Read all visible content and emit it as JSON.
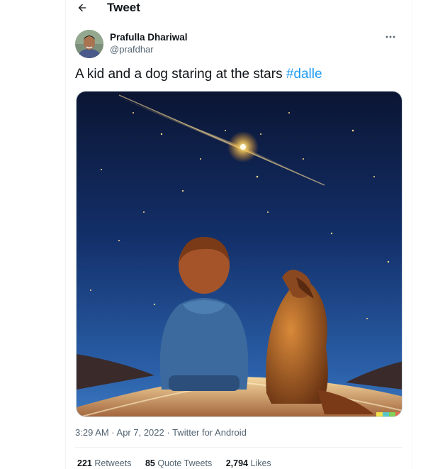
{
  "header": {
    "back_icon": "arrow-left-icon",
    "title": "Tweet"
  },
  "tweet": {
    "author": {
      "display_name": "Prafulla Dhariwal",
      "handle": "@prafdhar",
      "avatar_icon": "user-avatar"
    },
    "more_icon": "more-horizontal-icon",
    "text": "A kid and a dog staring at the stars ",
    "hashtag": "#dalle",
    "media_description": "image of a kid and a dog sitting on a ledge looking up at a shooting star",
    "timestamp": "3:29 AM · Apr 7, 2022",
    "separator": " · ",
    "source": "Twitter for Android",
    "stats": {
      "retweets_count": "221",
      "retweets_label": "Retweets",
      "quotes_count": "85",
      "quotes_label": "Quote Tweets",
      "likes_count": "2,794",
      "likes_label": "Likes"
    }
  },
  "colors": {
    "link": "#1d9bf0",
    "secondary_text": "#536471",
    "primary_text": "#0f1419"
  }
}
